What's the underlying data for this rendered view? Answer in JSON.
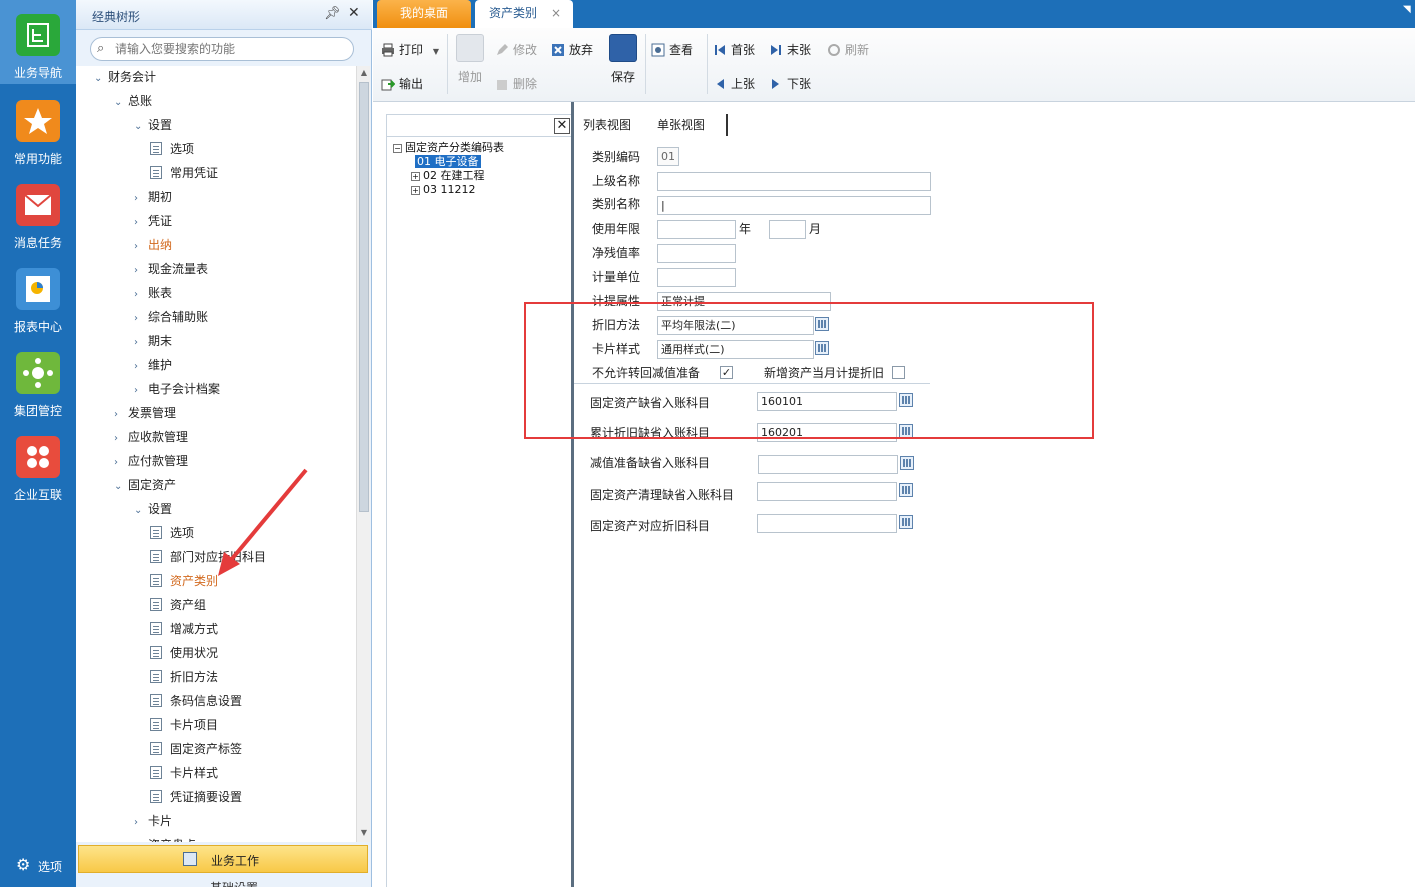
{
  "rail": {
    "items": [
      {
        "label": "业务导航",
        "icon": "business-nav-icon",
        "color": "#2aa83a"
      },
      {
        "label": "常用功能",
        "icon": "star-icon",
        "color": "#f08a1c"
      },
      {
        "label": "消息任务",
        "icon": "mail-icon",
        "color": "#e0463e"
      },
      {
        "label": "报表中心",
        "icon": "report-icon",
        "color": "#3d8fd6"
      },
      {
        "label": "集团管控",
        "icon": "group-control-icon",
        "color": "#6fb83c"
      },
      {
        "label": "企业互联",
        "icon": "enterprise-link-icon",
        "color": "#e84c3d"
      }
    ],
    "options_label": "选项"
  },
  "nav": {
    "title": "经典树形",
    "search_placeholder": "请输入您要搜索的功能",
    "tree": [
      {
        "label": "财务会计",
        "level": 0,
        "arrow": "down"
      },
      {
        "label": "总账",
        "level": 1,
        "arrow": "down"
      },
      {
        "label": "设置",
        "level": 2,
        "arrow": "down"
      },
      {
        "label": "选项",
        "level": 3,
        "doc": true
      },
      {
        "label": "常用凭证",
        "level": 3,
        "doc": true
      },
      {
        "label": "期初",
        "level": 2,
        "arrow": "right"
      },
      {
        "label": "凭证",
        "level": 2,
        "arrow": "right"
      },
      {
        "label": "出纳",
        "level": 2,
        "arrow": "right",
        "highlight": true
      },
      {
        "label": "现金流量表",
        "level": 2,
        "arrow": "right"
      },
      {
        "label": "账表",
        "level": 2,
        "arrow": "right"
      },
      {
        "label": "综合辅助账",
        "level": 2,
        "arrow": "right"
      },
      {
        "label": "期末",
        "level": 2,
        "arrow": "right"
      },
      {
        "label": "维护",
        "level": 2,
        "arrow": "right"
      },
      {
        "label": "电子会计档案",
        "level": 2,
        "arrow": "right"
      },
      {
        "label": "发票管理",
        "level": 1,
        "arrow": "right"
      },
      {
        "label": "应收款管理",
        "level": 1,
        "arrow": "right"
      },
      {
        "label": "应付款管理",
        "level": 1,
        "arrow": "right"
      },
      {
        "label": "固定资产",
        "level": 1,
        "arrow": "down"
      },
      {
        "label": "设置",
        "level": 2,
        "arrow": "down"
      },
      {
        "label": "选项",
        "level": 3,
        "doc": true
      },
      {
        "label": "部门对应折旧科目",
        "level": 3,
        "doc": true
      },
      {
        "label": "资产类别",
        "level": 3,
        "doc": true,
        "highlight": true
      },
      {
        "label": "资产组",
        "level": 3,
        "doc": true
      },
      {
        "label": "增减方式",
        "level": 3,
        "doc": true
      },
      {
        "label": "使用状况",
        "level": 3,
        "doc": true
      },
      {
        "label": "折旧方法",
        "level": 3,
        "doc": true
      },
      {
        "label": "条码信息设置",
        "level": 3,
        "doc": true
      },
      {
        "label": "卡片项目",
        "level": 3,
        "doc": true
      },
      {
        "label": "固定资产标签",
        "level": 3,
        "doc": true
      },
      {
        "label": "卡片样式",
        "level": 3,
        "doc": true
      },
      {
        "label": "凭证摘要设置",
        "level": 3,
        "doc": true
      },
      {
        "label": "卡片",
        "level": 2,
        "arrow": "right"
      },
      {
        "label": "资产盘点",
        "level": 2,
        "arrow": "right"
      }
    ],
    "business_work": "业务工作",
    "basic_settings": "基础设置"
  },
  "tabs": {
    "desk": "我的桌面",
    "asset_class": "资产类别",
    "close": "×"
  },
  "toolbar": {
    "print": "打印",
    "export": "输出",
    "add": "增加",
    "modify": "修改",
    "delete": "删除",
    "discard": "放弃",
    "save": "保存",
    "view": "查看",
    "first": "首张",
    "last": "末张",
    "prev": "上张",
    "next": "下张",
    "refresh": "刷新"
  },
  "class_tree": {
    "root": "固定资产分类编码表",
    "items": [
      {
        "code": "01",
        "name": "电子设备",
        "selected": true
      },
      {
        "code": "02",
        "name": "在建工程"
      },
      {
        "code": "03",
        "name": "11212"
      }
    ]
  },
  "form": {
    "view_tabs": {
      "list": "列表视图",
      "single": "单张视图"
    },
    "class_code": {
      "label": "类别编码",
      "value": "01"
    },
    "parent_name": {
      "label": "上级名称",
      "value": ""
    },
    "class_name": {
      "label": "类别名称",
      "value": "|"
    },
    "useful_life": {
      "label": "使用年限",
      "year_unit": "年",
      "month_unit": "月",
      "years": "",
      "months": ""
    },
    "salvage_rate": {
      "label": "净残值率",
      "value": ""
    },
    "unit": {
      "label": "计量单位",
      "value": ""
    },
    "accrual_attr": {
      "label": "计提属性",
      "value": "正常计提"
    },
    "depr_method": {
      "label": "折旧方法",
      "value": "平均年限法(二)"
    },
    "card_style": {
      "label": "卡片样式",
      "value": "通用样式(二)"
    },
    "no_reverse": {
      "label": "不允许转回减值准备",
      "checked": true
    },
    "new_month_depr": {
      "label": "新增资产当月计提折旧",
      "checked": false
    },
    "fa_default_account": {
      "label": "固定资产缺省入账科目",
      "value": "160101"
    },
    "acc_depr_account": {
      "label": "累计折旧缺省入账科目",
      "value": "160201"
    },
    "impairment_account": {
      "label": "减值准备缺省入账科目",
      "value": ""
    },
    "fa_cleanup_account": {
      "label": "固定资产清理缺省入账科目",
      "value": ""
    },
    "fa_depr_account": {
      "label": "固定资产对应折旧科目",
      "value": ""
    }
  },
  "colors": {
    "accent": "#1d6fb8",
    "annotation": "#e43b3b",
    "tab_orange": "#f08f10"
  }
}
